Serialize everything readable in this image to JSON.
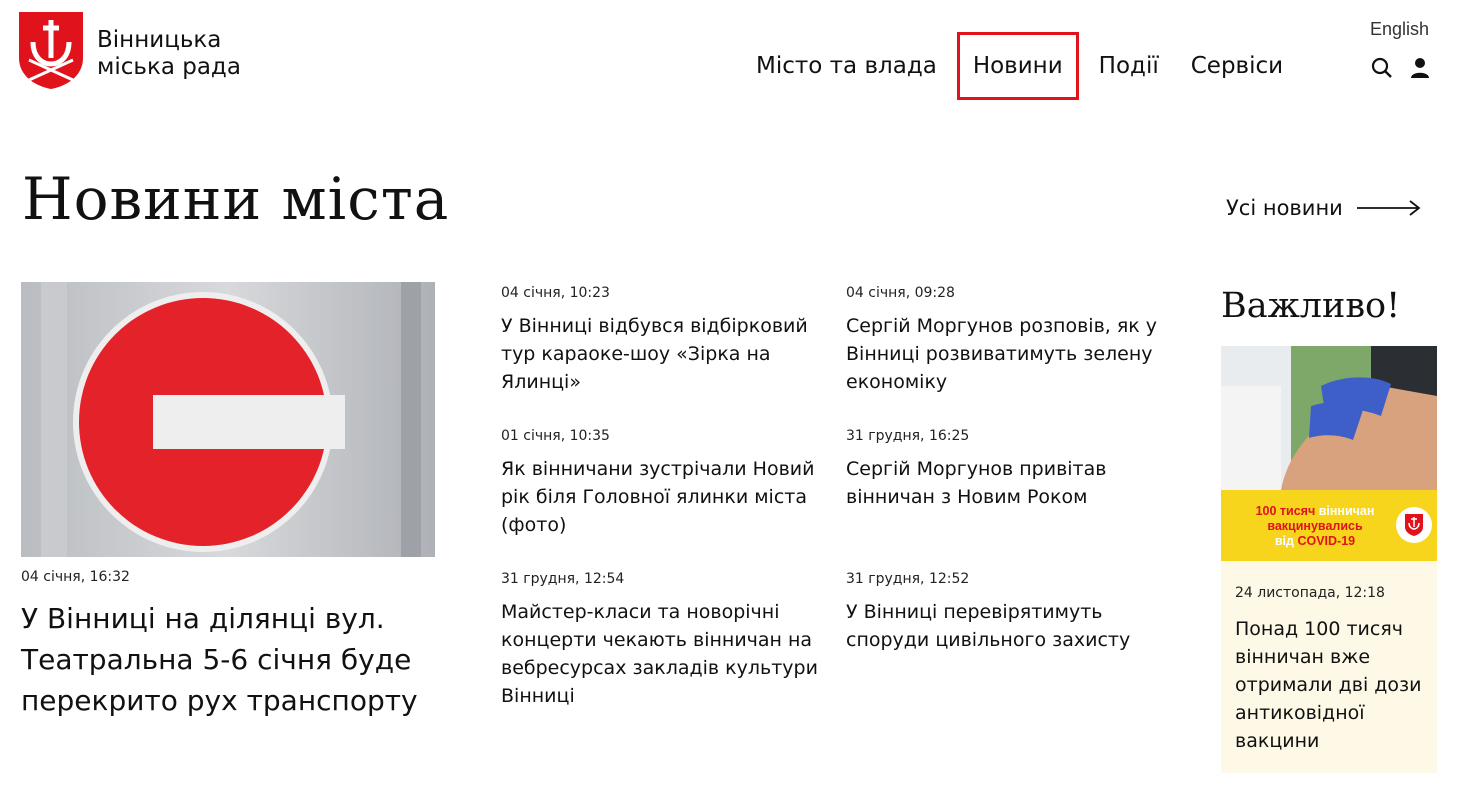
{
  "header": {
    "logo_line1": "Вінницька",
    "logo_line2": "міська рада",
    "lang": "English",
    "nav": [
      {
        "label": "Місто та влада",
        "active": false
      },
      {
        "label": "Новини",
        "active": true
      },
      {
        "label": "Події",
        "active": false
      },
      {
        "label": "Сервіси",
        "active": false
      }
    ],
    "icons": [
      "search-icon",
      "user-icon"
    ]
  },
  "section": {
    "title": "Новини міста",
    "all_news": "Усі новини"
  },
  "featured": {
    "date": "04 січня, 16:32",
    "title": "У Вінниці на ділянці вул. Театральна 5-6 січня буде перекрито рух транспорту"
  },
  "news": [
    {
      "date": "04 січня, 10:23",
      "title": "У Вінниці відбувся відбірковий тур караоке-шоу «Зірка на Ялинці»"
    },
    {
      "date": "04 січня, 09:28",
      "title": "Сергій Моргунов розповів, як у Вінниці розвиватимуть зелену економіку"
    },
    {
      "date": "01 січня, 10:35",
      "title": "Як вінничани зустрічали Новий рік біля Головної ялинки міста (фото)"
    },
    {
      "date": "31 грудня, 16:25",
      "title": "Сергій Моргунов привітав вінничан з Новим Роком"
    },
    {
      "date": "31 грудня, 12:54",
      "title": "Майстер-класи та новорічні концерти чекають вінничан на вебресурсах закладів культури Вінниці"
    },
    {
      "date": "31 грудня, 12:52",
      "title": "У Вінниці перевірятимуть споруди цивільного захисту"
    }
  ],
  "important": {
    "title": "Важливо!",
    "banner_red1": "100 тисяч",
    "banner_white1": "вінничан",
    "banner_red2": "вакцинувались",
    "banner_white2": "від",
    "banner_red3": "COVID-19",
    "date": "24 листопада, 12:18",
    "text": "Понад 100 тисяч вінничан вже отримали дві дози антиковідної вакцини"
  },
  "colors": {
    "brand_red": "#e0121c",
    "banner_yellow": "#f7d51c",
    "card_bg": "#fdf9e6"
  }
}
